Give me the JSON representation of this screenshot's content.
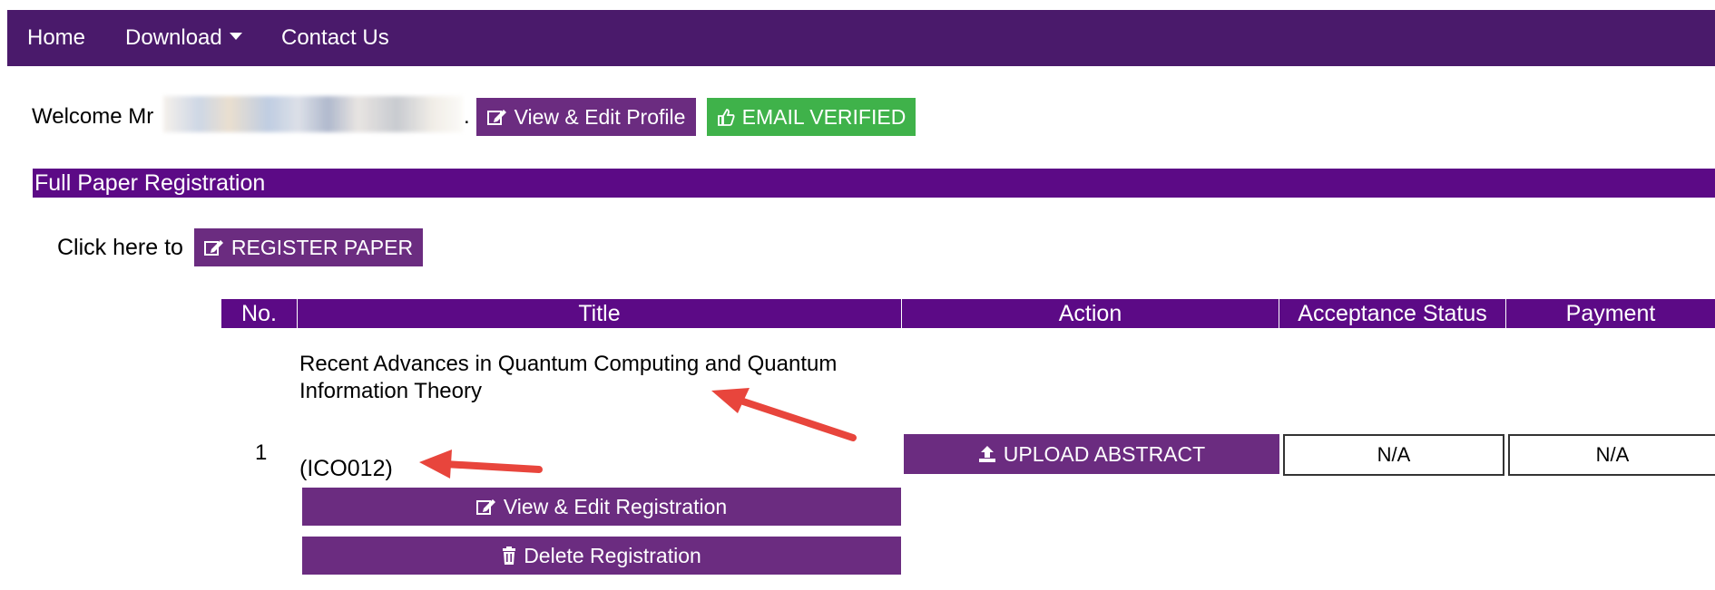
{
  "nav": {
    "items": [
      {
        "label": "Home"
      },
      {
        "label": "Download",
        "has_dropdown": true
      },
      {
        "label": "Contact Us"
      }
    ]
  },
  "welcome": {
    "prefix": "Welcome Mr",
    "suffix": ".",
    "profile_button": "View & Edit Profile",
    "email_badge": "EMAIL VERIFIED"
  },
  "section": {
    "title": "Full Paper Registration"
  },
  "register": {
    "prompt": "Click here to",
    "button": "REGISTER PAPER"
  },
  "table": {
    "headers": [
      "No.",
      "Title",
      "Action",
      "Acceptance Status",
      "Payment"
    ],
    "rows": [
      {
        "no": "1",
        "title": "Recent Advances in Quantum Computing and Quantum Information Theory",
        "code": "(ICO012)",
        "edit_button": "View & Edit Registration",
        "delete_button": "Delete Registration",
        "action_button": "UPLOAD ABSTRACT",
        "acceptance_status": "N/A",
        "payment": "N/A"
      }
    ]
  },
  "colors": {
    "nav_bg": "#4a1a6b",
    "header_bg": "#5c0a86",
    "button_purple": "#6b2c80",
    "button_green": "#3fb24a",
    "annotation_arrow": "#e8453c"
  }
}
